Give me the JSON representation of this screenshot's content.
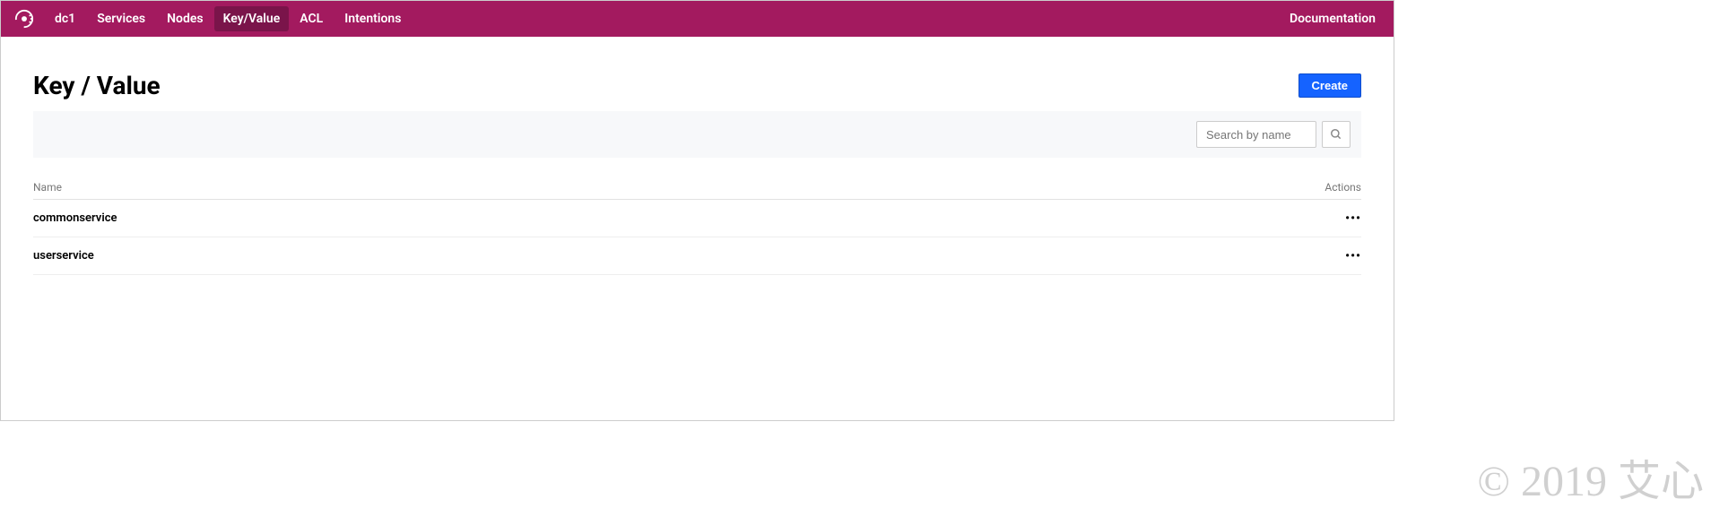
{
  "nav": {
    "datacenter": "dc1",
    "items": [
      "Services",
      "Nodes",
      "Key/Value",
      "ACL",
      "Intentions"
    ],
    "active_index": 2,
    "right": "Documentation"
  },
  "page": {
    "title": "Key / Value",
    "create_label": "Create"
  },
  "search": {
    "placeholder": "Search by name"
  },
  "table": {
    "header_name": "Name",
    "header_actions": "Actions",
    "rows": [
      {
        "name": "commonservice"
      },
      {
        "name": "userservice"
      }
    ]
  },
  "watermark": "© 2019 艾心"
}
